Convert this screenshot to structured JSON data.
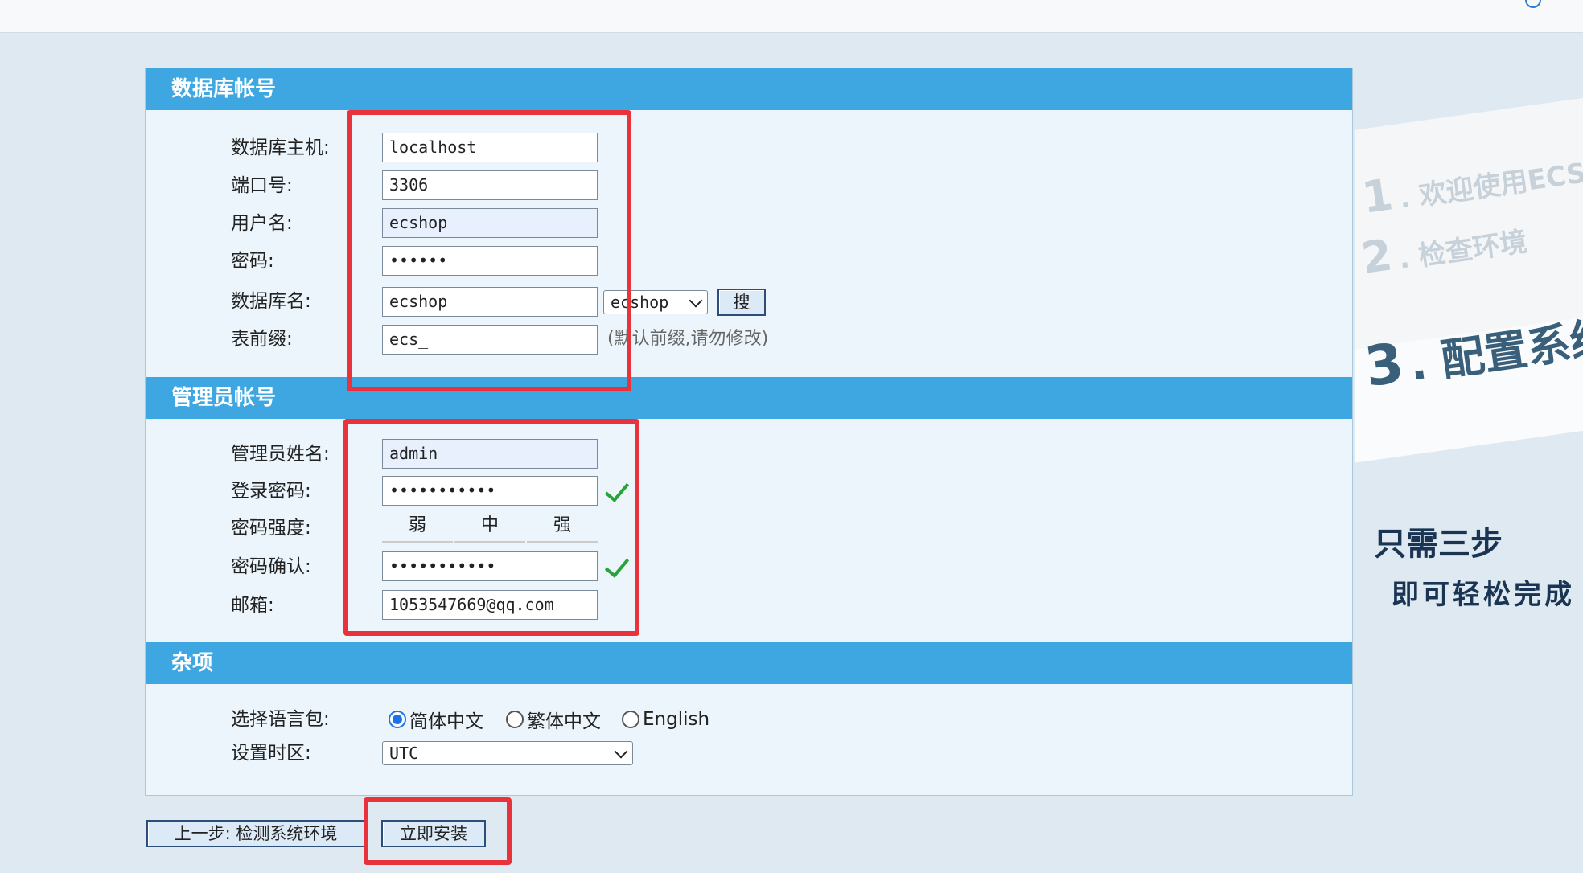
{
  "sections": {
    "db_title": "数据库帐号",
    "admin_title": "管理员帐号",
    "misc_title": "杂项"
  },
  "db": {
    "host_label": "数据库主机:",
    "host_value": "localhost",
    "port_label": "端口号:",
    "port_value": "3306",
    "user_label": "用户名:",
    "user_value": "ecshop",
    "pass_label": "密码:",
    "pass_value": "••••••",
    "name_label": "数据库名:",
    "name_value": "ecshop",
    "name_select": "ecshop",
    "search_button": "搜",
    "prefix_label": "表前缀:",
    "prefix_value": "ecs_",
    "prefix_hint": "(默认前缀,请勿修改)"
  },
  "admin": {
    "name_label": "管理员姓名:",
    "name_value": "admin",
    "pass_label": "登录密码:",
    "pass_value": "•••••••••••",
    "strength_label": "密码强度:",
    "strength_levels": [
      "弱",
      "中",
      "强"
    ],
    "strength_active": 1,
    "confirm_label": "密码确认:",
    "confirm_value": "•••••••••••",
    "email_label": "邮箱:",
    "email_value": "1053547669@qq.com"
  },
  "misc": {
    "lang_label": "选择语言包:",
    "lang_options": [
      "简体中文",
      "繁体中文",
      "English"
    ],
    "lang_selected": 0,
    "tz_label": "设置时区:",
    "tz_value": "UTC"
  },
  "buttons": {
    "prev": "上一步: 检测系统环境",
    "install": "立即安装"
  },
  "sidebar": {
    "step1_num": "1",
    "step1_text": ". 欢迎使用ECSHOP",
    "step2_num": "2",
    "step2_text": ". 检查环境",
    "step3_num": "3",
    "step3_text": ". 配置系统",
    "promo_line1": "只需三步",
    "promo_line2": "即可轻松完成"
  },
  "colors": {
    "section_header": "#3ea7e2",
    "highlight_box": "#e8323c",
    "check": "#27a33a",
    "strength_active": "#f08c00"
  }
}
